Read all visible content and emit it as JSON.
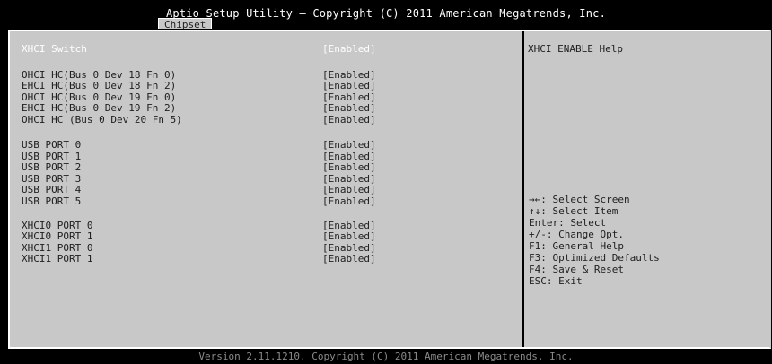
{
  "header": {
    "title": "Aptio Setup Utility – Copyright (C) 2011 American Megatrends, Inc.",
    "tab": "Chipset"
  },
  "settings": [
    {
      "label": "XHCI Switch",
      "value": "[Enabled]",
      "selected": true
    },
    {
      "label": "OHCI HC(Bus 0 Dev 18 Fn 0)",
      "value": "[Enabled]"
    },
    {
      "label": "EHCI HC(Bus 0 Dev 18 Fn 2)",
      "value": "[Enabled]"
    },
    {
      "label": "OHCI HC(Bus 0 Dev 19 Fn 0)",
      "value": "[Enabled]"
    },
    {
      "label": "EHCI HC(Bus 0 Dev 19 Fn 2)",
      "value": "[Enabled]"
    },
    {
      "label": "OHCI HC (Bus 0 Dev 20 Fn 5)",
      "value": "[Enabled]"
    },
    {
      "label": "USB PORT 0",
      "value": "[Enabled]"
    },
    {
      "label": "USB PORT 1",
      "value": "[Enabled]"
    },
    {
      "label": "USB PORT 2",
      "value": "[Enabled]"
    },
    {
      "label": "USB PORT 3",
      "value": "[Enabled]"
    },
    {
      "label": "USB PORT 4",
      "value": "[Enabled]"
    },
    {
      "label": "USB PORT 5",
      "value": "[Enabled]"
    },
    {
      "label": "XHCI0 PORT 0",
      "value": "[Enabled]"
    },
    {
      "label": "XHCI0 PORT 1",
      "value": "[Enabled]"
    },
    {
      "label": "XHCI1 PORT 0",
      "value": "[Enabled]"
    },
    {
      "label": "XHCI1 PORT 1",
      "value": "[Enabled]"
    }
  ],
  "help": {
    "text": "XHCI ENABLE Help"
  },
  "keys": [
    "→←: Select Screen",
    "↑↓: Select Item",
    "Enter: Select",
    "+/-: Change Opt.",
    "F1: General Help",
    "F3: Optimized Defaults",
    "F4: Save & Reset",
    "ESC: Exit"
  ],
  "footer": {
    "text": "Version 2.11.1210. Copyright (C) 2011 American Megatrends, Inc."
  },
  "colors": {
    "panel_bg": "#c8c8c8",
    "text": "#202020",
    "highlight": "#ffffff",
    "footer_text": "#8a8a8a"
  }
}
